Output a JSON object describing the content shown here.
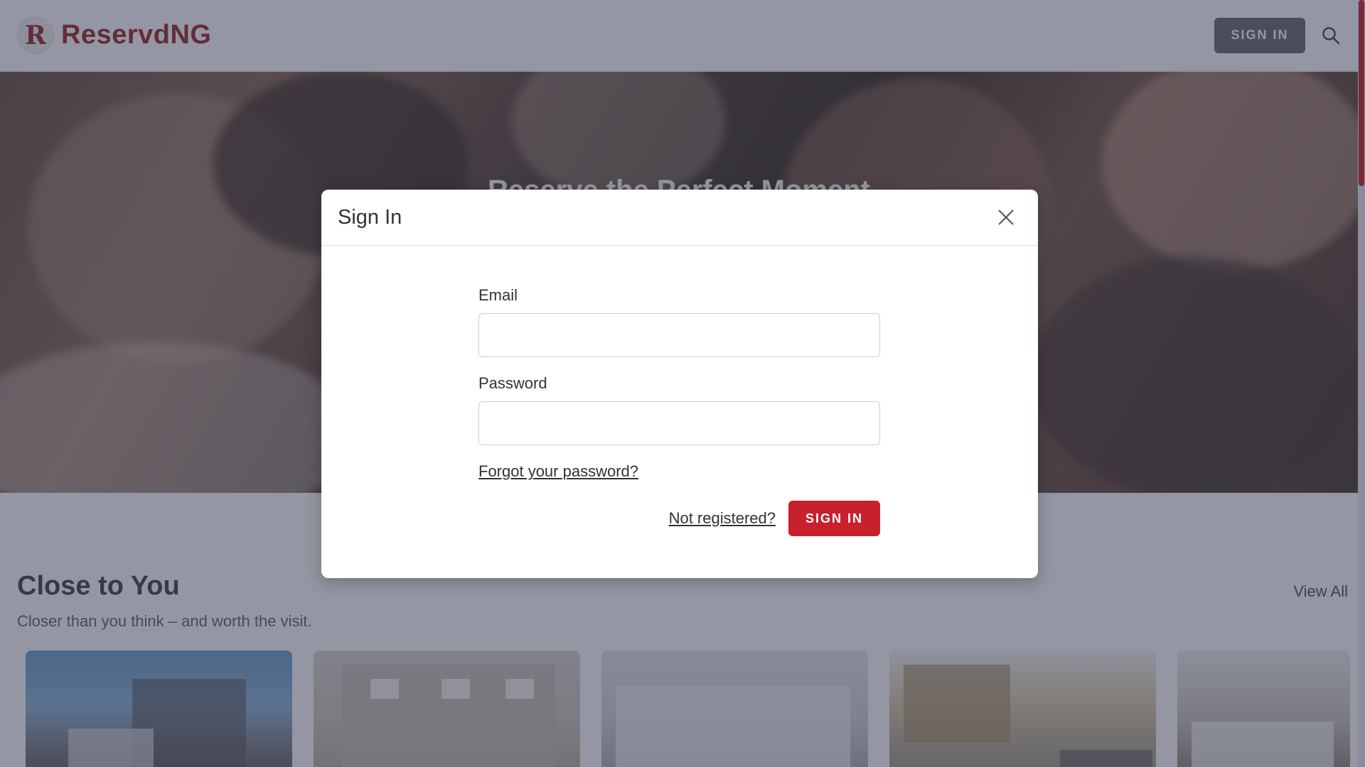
{
  "header": {
    "logo_letter": "R",
    "brand": "ReservdNG",
    "signin_label": "SIGN IN"
  },
  "hero": {
    "title": "Reserve the Perfect Moment"
  },
  "close_to_you": {
    "title": "Close to You",
    "subtitle": "Closer than you think – and worth the visit.",
    "view_all": "View All"
  },
  "modal": {
    "title": "Sign In",
    "email_label": "Email",
    "email_value": "",
    "password_label": "Password",
    "password_value": "",
    "forgot_link": "Forgot your password?",
    "not_registered": "Not registered?",
    "signin_label": "SIGN IN"
  },
  "colors": {
    "brand": "#9b2a2a",
    "primary_button": "#c8202d",
    "overlay": "rgba(42,48,72,0.5)"
  },
  "icons": [
    "logo-icon",
    "search-icon",
    "close-icon"
  ]
}
